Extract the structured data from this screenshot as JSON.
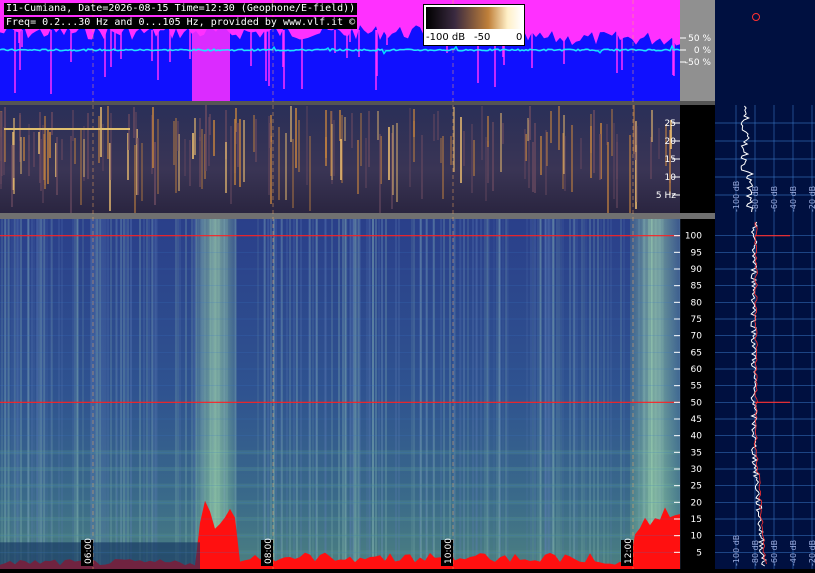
{
  "header": {
    "title_line1": "I1-Cumiana, Date=2026-08-15 Time=12:30 (Geophone/E-field))",
    "title_line2": "Freq= 0.2...30 Hz and 0...105 Hz, provided by www.vlf.it ©"
  },
  "colorscale": {
    "labels": [
      "-100 dB",
      "-50",
      "0"
    ]
  },
  "colors": {
    "waveform_bg": "#1010ff",
    "waveform_top": "#ff30ff",
    "waveform_trace": "#00e0ff",
    "marker_red": "#ff2020",
    "panel_gray": "#909090",
    "right_panel_bg": "#001040",
    "grid_blue": "#3a78c8"
  },
  "chart_data": [
    {
      "type": "line",
      "panel": "amplitude",
      "y_ticks": [
        "50 %",
        "0 %",
        "-50 %"
      ],
      "ylim": [
        -100,
        100
      ]
    },
    {
      "type": "heatmap",
      "panel": "low-frequency spectrogram",
      "y_ticks": [
        "25",
        "20",
        "15",
        "10",
        "5 Hz"
      ],
      "ylim": [
        0,
        30
      ]
    },
    {
      "type": "heatmap",
      "panel": "wideband spectrogram",
      "y_ticks": [
        "100",
        "95",
        "90",
        "85",
        "80",
        "75",
        "70",
        "65",
        "60",
        "55",
        "50",
        "45",
        "40",
        "35",
        "30",
        "25",
        "20",
        "15",
        "10",
        "5"
      ],
      "ylim": [
        0,
        105
      ],
      "time_labels": [
        "06:00",
        "08:00",
        "10:00",
        "12:00"
      ],
      "markers_hz": [
        100,
        50
      ]
    },
    {
      "type": "line",
      "panel": "average spectrum",
      "x_ticks": [
        "-100 dB",
        "-80 dB",
        "-60 dB",
        "-40 dB",
        "-20 dB"
      ],
      "x_ticks_upper": [
        "-100 dB",
        "-80 dB",
        "-60 dB",
        "-40 dB",
        "-20 dB"
      ]
    }
  ]
}
